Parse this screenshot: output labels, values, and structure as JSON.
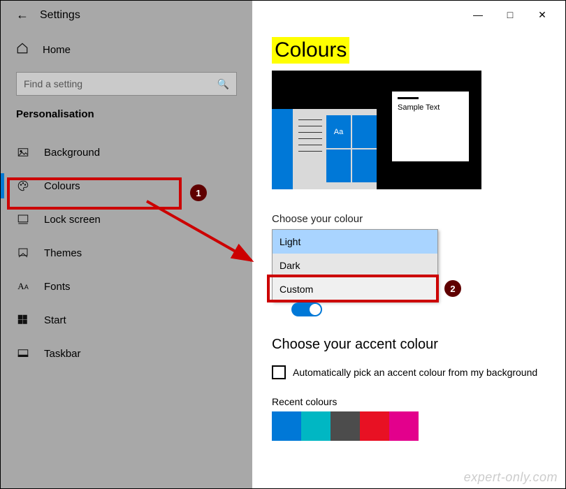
{
  "app_title": "Settings",
  "sidebar": {
    "home": "Home",
    "search_placeholder": "Find a setting",
    "section": "Personalisation",
    "items": [
      {
        "label": "Background"
      },
      {
        "label": "Colours"
      },
      {
        "label": "Lock screen"
      },
      {
        "label": "Themes"
      },
      {
        "label": "Fonts"
      },
      {
        "label": "Start"
      },
      {
        "label": "Taskbar"
      }
    ]
  },
  "page": {
    "title": "Colours",
    "preview": {
      "tile_text": "Aa",
      "window_text": "Sample Text"
    },
    "choose_colour": {
      "label": "Choose your colour",
      "options": [
        "Light",
        "Dark",
        "Custom"
      ],
      "toggle_label": "On"
    },
    "accent": {
      "heading": "Choose your accent colour",
      "auto_label": "Automatically pick an accent colour from my background",
      "recent_label": "Recent colours",
      "recent": [
        "#0078d7",
        "#00b7c3",
        "#4c4c4c",
        "#e81123",
        "#e3008c"
      ]
    }
  },
  "annotations": {
    "num1": "1",
    "num2": "2"
  },
  "watermark": "expert-only.com"
}
